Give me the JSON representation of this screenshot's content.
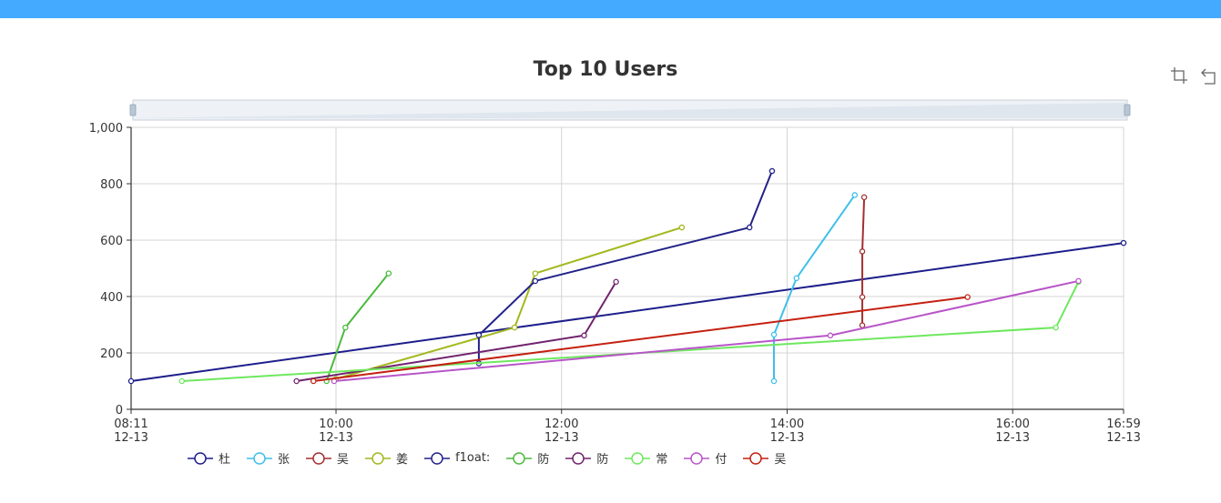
{
  "chart_data": {
    "type": "line",
    "title": "Top 10 Users",
    "xlabel": "",
    "ylabel": "",
    "ylim": [
      0,
      1000
    ],
    "xlim": [
      "12-13 08:11",
      "12-13 16:59"
    ],
    "yticks": [
      "0",
      "200",
      "400",
      "600",
      "800",
      "1,000"
    ],
    "xticks": [
      {
        "t": "08:11",
        "time": "08:11",
        "date": "12-13"
      },
      {
        "t": "10:00",
        "time": "10:00",
        "date": "12-13"
      },
      {
        "t": "12:00",
        "time": "12:00",
        "date": "12-13"
      },
      {
        "t": "14:00",
        "time": "14:00",
        "date": "12-13"
      },
      {
        "t": "16:00",
        "time": "16:00",
        "date": "12-13"
      },
      {
        "t": "16:59",
        "time": "16:59",
        "date": "12-13"
      }
    ],
    "grid": true,
    "legend_position": "bottom",
    "series": [
      {
        "name": "杜",
        "color": "#1e1e8c",
        "points": [
          [
            "08:11",
            100
          ],
          [
            "16:59",
            590
          ]
        ]
      },
      {
        "name": "张",
        "color": "#3fbfe8",
        "points": [
          [
            "13:53",
            100
          ],
          [
            "13:53",
            265
          ],
          [
            "14:05",
            465
          ],
          [
            "14:36",
            760
          ]
        ]
      },
      {
        "name": "吴",
        "color": "#a33030",
        "points": [
          [
            "14:40",
            298
          ],
          [
            "14:40",
            398
          ],
          [
            "14:40",
            560
          ],
          [
            "14:41",
            752
          ]
        ]
      },
      {
        "name": "姜",
        "color": "#a3b81c",
        "points": [
          [
            "10:00",
            108
          ],
          [
            "11:35",
            290
          ],
          [
            "11:46",
            482
          ],
          [
            "13:04",
            645
          ]
        ]
      },
      {
        "name": "f1oat:",
        "color": "#22228a",
        "points": [
          [
            "11:16",
            163
          ],
          [
            "11:16",
            263
          ],
          [
            "11:46",
            455
          ],
          [
            "13:40",
            645
          ],
          [
            "13:52",
            845
          ]
        ]
      },
      {
        "name": "防",
        "color": "#4cba3e",
        "points": [
          [
            "09:55",
            100
          ],
          [
            "10:05",
            290
          ],
          [
            "10:28",
            482
          ]
        ]
      },
      {
        "name": "防",
        "color": "#70236e",
        "points": [
          [
            "09:39",
            100
          ],
          [
            "12:12",
            262
          ],
          [
            "12:29",
            452
          ]
        ]
      },
      {
        "name": "常",
        "color": "#6ee85e",
        "points": [
          [
            "08:38",
            100
          ],
          [
            "16:23",
            290
          ],
          [
            "16:35",
            452
          ]
        ]
      },
      {
        "name": "付",
        "color": "#b855c8",
        "points": [
          [
            "09:59",
            100
          ],
          [
            "14:23",
            262
          ],
          [
            "16:35",
            455
          ]
        ]
      },
      {
        "name": "吴",
        "color": "#c42010",
        "points": [
          [
            "09:48",
            100
          ],
          [
            "15:36",
            398
          ]
        ]
      }
    ]
  },
  "toolbox": {
    "zoom_icon": "data-zoom-icon",
    "restore_icon": "zoom-restore-icon"
  }
}
